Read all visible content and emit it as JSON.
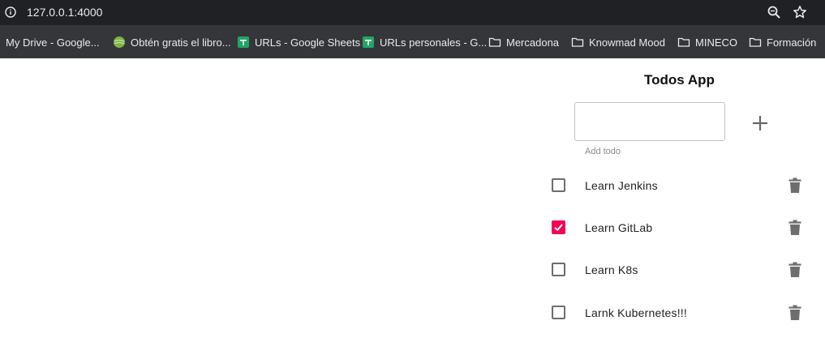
{
  "browser": {
    "url": "127.0.0.1:4000",
    "icon_info": "info-icon",
    "icon_zoom": "zoom-icon",
    "icon_star": "star-icon"
  },
  "bookmarks": [
    {
      "label": "My Drive - Google...",
      "icon": "none"
    },
    {
      "label": "Obtén gratis el libro...",
      "icon": "globe-icon"
    },
    {
      "label": "URLs - Google Sheets",
      "icon": "sheets-icon"
    },
    {
      "label": "URLs personales - G...",
      "icon": "sheets-icon"
    },
    {
      "label": "Mercadona",
      "icon": "folder-icon"
    },
    {
      "label": "Knowmad Mood",
      "icon": "folder-icon"
    },
    {
      "label": "MINECO",
      "icon": "folder-icon"
    },
    {
      "label": "Formación",
      "icon": "folder-icon"
    }
  ],
  "app": {
    "title": "Todos App",
    "input_value": "",
    "input_helper": "Add todo",
    "add_icon": "plus-icon",
    "accent_color": "#f50057"
  },
  "todos": [
    {
      "label": "Learn Jenkins",
      "checked": false
    },
    {
      "label": "Learn GitLab",
      "checked": true
    },
    {
      "label": "Learn K8s",
      "checked": false
    },
    {
      "label": "Larnk Kubernetes!!!",
      "checked": false
    }
  ]
}
